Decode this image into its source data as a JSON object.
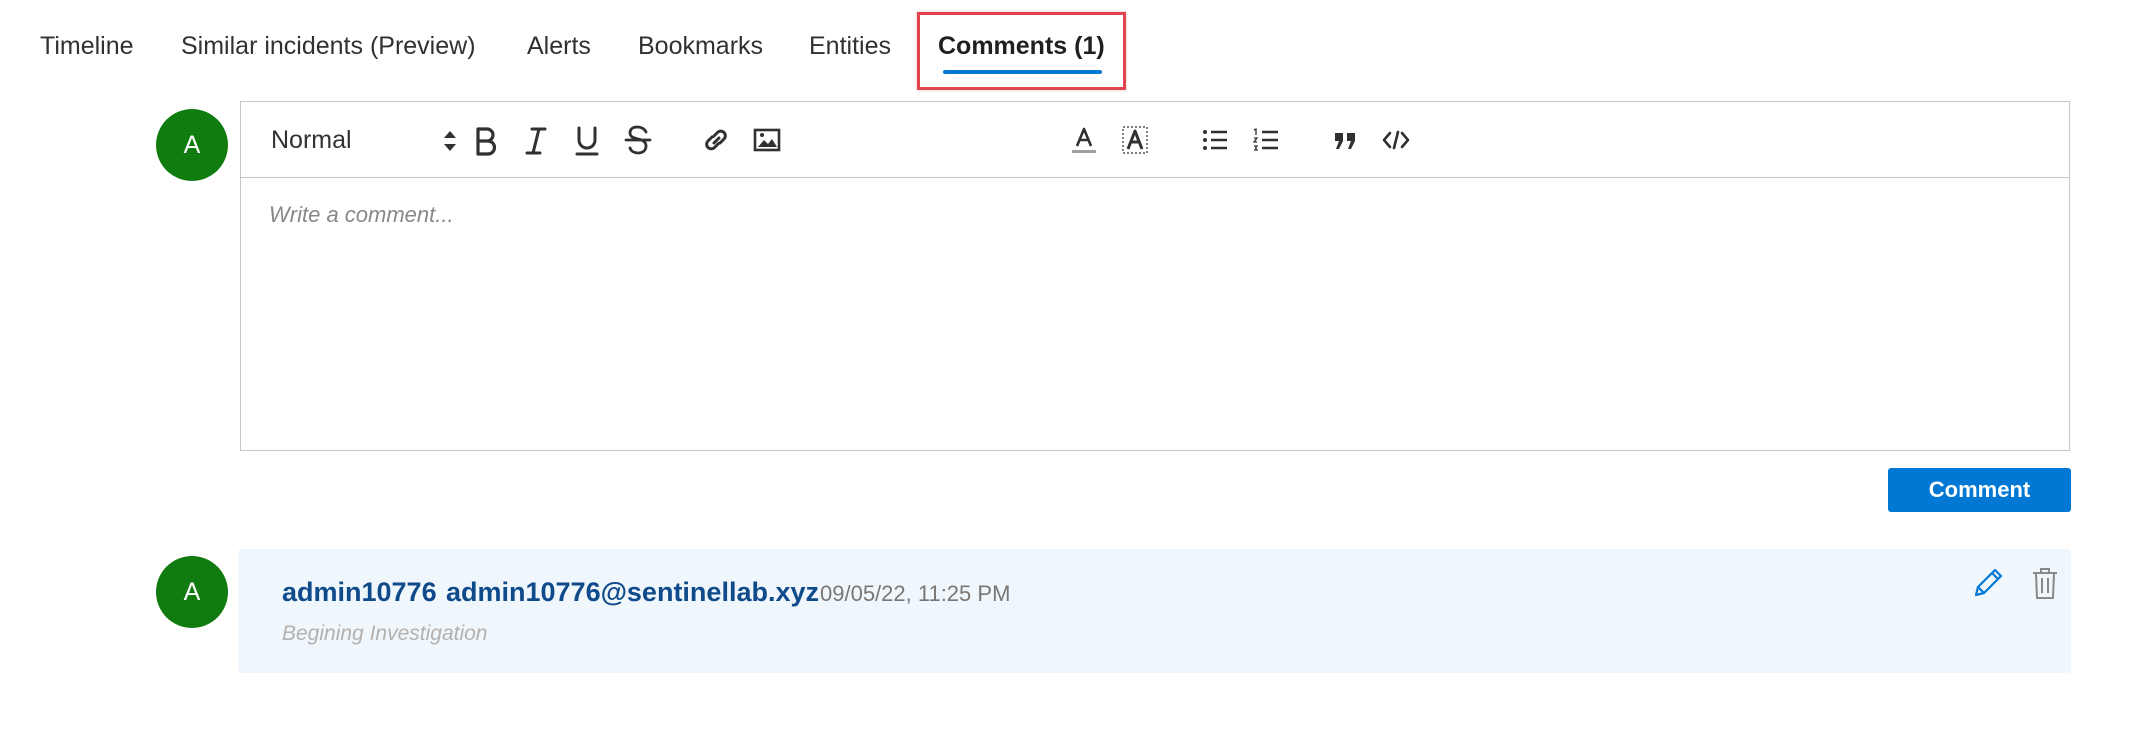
{
  "tabs": [
    {
      "label": "Timeline"
    },
    {
      "label": "Similar incidents (Preview)"
    },
    {
      "label": "Alerts"
    },
    {
      "label": "Bookmarks"
    },
    {
      "label": "Entities"
    },
    {
      "label": "Comments (1)",
      "active": true
    }
  ],
  "composer": {
    "avatar_initial": "A",
    "format_select": "Normal",
    "placeholder": "Write a comment...",
    "toolbar_icons": [
      "bold-icon",
      "italic-icon",
      "underline-icon",
      "strikethrough-icon",
      "link-icon",
      "image-icon",
      "font-color-icon",
      "highlight-color-icon",
      "bullet-list-icon",
      "numbered-list-icon",
      "quote-icon",
      "code-icon"
    ],
    "submit_label": "Comment"
  },
  "comments": [
    {
      "avatar_initial": "A",
      "author": "admin10776",
      "email": "admin10776@sentinellab.xyz",
      "timestamp": "09/05/22, 11:25 PM",
      "text": "Begining Investigation",
      "actions": [
        "edit-icon",
        "delete-icon"
      ]
    }
  ],
  "colors": {
    "accent": "#0078d4",
    "avatar": "#107c10",
    "highlight_box": "#e0454f",
    "comment_card_bg": "#eff6fc",
    "author_text": "#0f4a8a"
  }
}
